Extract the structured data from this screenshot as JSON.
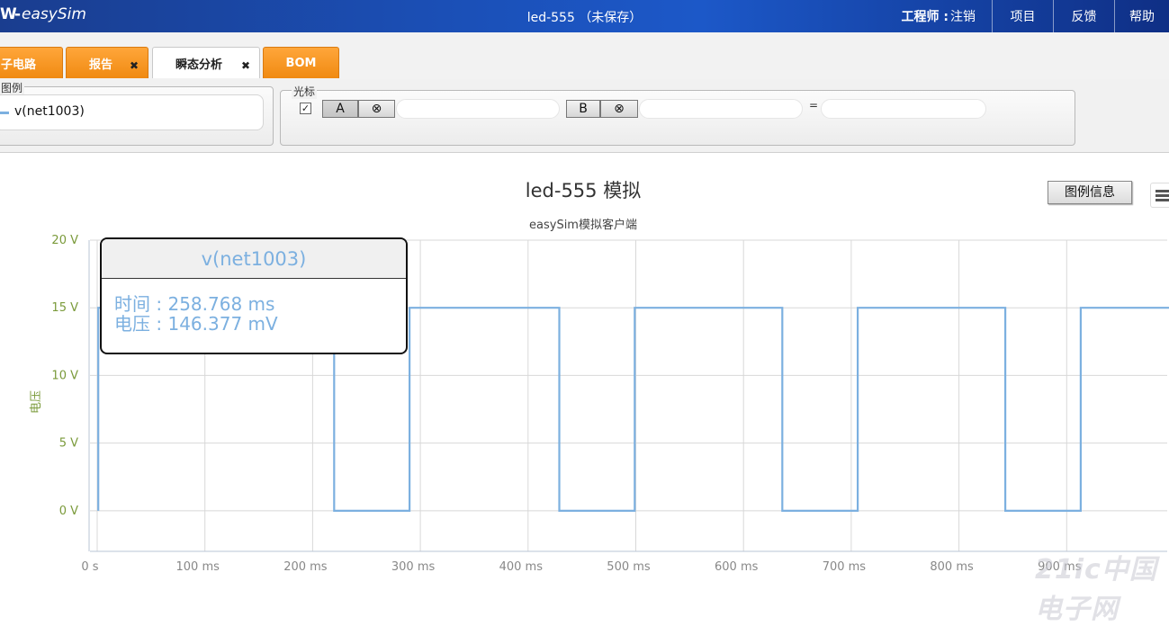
{
  "header": {
    "logo_mark": "W-",
    "logo_text": "easySim",
    "doc_title": "led-555 （未保存）",
    "user_label": "工程师 :",
    "logout_label": "注销",
    "nav_items": [
      "项目",
      "反馈",
      "帮助"
    ]
  },
  "tabs": [
    {
      "label": "子电路",
      "closable": false
    },
    {
      "label": "报告",
      "closable": true,
      "close_glyph": "✖"
    },
    {
      "label": "瞬态分析",
      "closable": true,
      "active": true,
      "close_glyph": "✖"
    },
    {
      "label": "BOM",
      "closable": false
    }
  ],
  "legend_panel": {
    "title": "图例",
    "entry": "v(net1003)",
    "entry_color": "#7cb0e0"
  },
  "cursor_panel": {
    "title": "光标",
    "checkbox_glyph": "✓",
    "checked": true,
    "button_a": "A",
    "button_b": "B",
    "clear_glyph": "⊗",
    "equals": "="
  },
  "chart_data": {
    "type": "line",
    "title": "led-555 模拟",
    "subtitle": "easySim模拟客户端",
    "ylabel": "电压",
    "xlabel": "",
    "x_unit": "ms",
    "y_unit": "V",
    "xlim": [
      0,
      1000
    ],
    "ylim": [
      -3,
      20
    ],
    "x_ticks": [
      0,
      100,
      200,
      300,
      400,
      500,
      600,
      700,
      800,
      900
    ],
    "x_tick_labels": [
      "0 s",
      "100 ms",
      "200 ms",
      "300 ms",
      "400 ms",
      "500 ms",
      "600 ms",
      "700 ms",
      "800 ms",
      "900 ms"
    ],
    "y_ticks": [
      0,
      5,
      10,
      15,
      20
    ],
    "y_tick_labels": [
      "0 V",
      "5 V",
      "10 V",
      "15 V",
      "20 V"
    ],
    "grid": true,
    "series": [
      {
        "name": "v(net1003)",
        "color": "#7cb0e0",
        "x": [
          1,
          1,
          220,
          220,
          290,
          290,
          429,
          429,
          499,
          499,
          636,
          636,
          706,
          706,
          843,
          843,
          913,
          913,
          1000
        ],
        "y": [
          0,
          15,
          15,
          0,
          0,
          15,
          15,
          0,
          0,
          15,
          15,
          0,
          0,
          15,
          15,
          0,
          0,
          15,
          15
        ]
      }
    ]
  },
  "legend_info_button": "图例信息",
  "tooltip": {
    "title": "v(net1003)",
    "time_label": "时间 :",
    "time_value": "258.768 ms",
    "voltage_label": "电压 :",
    "voltage_value": "146.377 mV"
  },
  "watermark": "21ic中国电子网"
}
